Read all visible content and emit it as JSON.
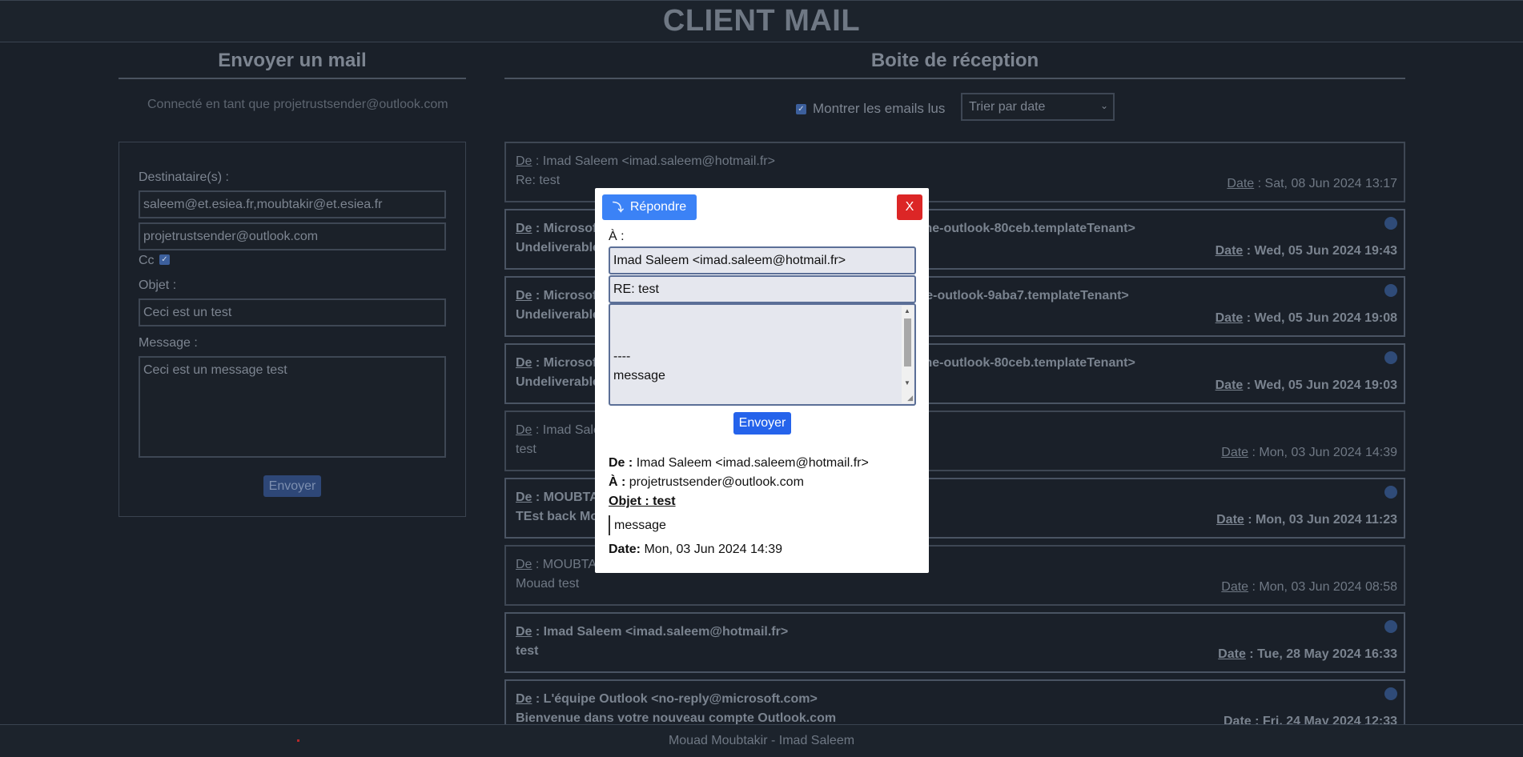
{
  "app": {
    "title": "CLIENT MAIL",
    "footer": "Mouad Moubtakir - Imad Saleem"
  },
  "compose": {
    "title": "Envoyer un mail",
    "connected_as": "Connecté en tant que projetrustsender@outlook.com",
    "to_label": "Destinataire(s) :",
    "to_value": "saleem@et.esiea.fr,moubtakir@et.esiea.fr",
    "cc_value": "projetrustsender@outlook.com",
    "cc_label": "Cc",
    "cc_checked": true,
    "subject_label": "Objet :",
    "subject_value": "Ceci est un test",
    "message_label": "Message :",
    "message_value": "Ceci est un message test",
    "send_label": "Envoyer"
  },
  "inbox": {
    "title": "Boite de réception",
    "show_read_label": "Montrer les emails lus",
    "show_read_checked": true,
    "sort_selected": "Trier par date",
    "from_prefix": "De",
    "date_prefix": "Date",
    "emails": [
      {
        "from": "Imad Saleem <imad.saleem@hotmail.fr>",
        "subject": "Re: test",
        "date": "Sat, 08 Jun 2024 13:17",
        "unread": false
      },
      {
        "from": "Microsoft Outlook <...5ab6ce41109e@sct-15-20-4755-11-msonline-outlook-80ceb.templateTenant>",
        "subject": "Undeliverable",
        "date": "Wed, 05 Jun 2024 19:43",
        "unread": true
      },
      {
        "from": "Microsoft Outlook <...5ab6ce41109e@sct-15-20-4801-0-msonline-outlook-9aba7.templateTenant>",
        "subject": "Undeliverable",
        "date": "Wed, 05 Jun 2024 19:08",
        "unread": true
      },
      {
        "from": "Microsoft Outlook <...5ab6ce41109e@sct-15-20-4755-11-msonline-outlook-80ceb.templateTenant>",
        "subject": "Undeliverable",
        "date": "Wed, 05 Jun 2024 19:03",
        "unread": true
      },
      {
        "from": "Imad Saleem <imad.saleem@hotmail.fr>",
        "subject": "test",
        "date": "Mon, 03 Jun 2024 14:39",
        "unread": false
      },
      {
        "from": "MOUBTAKIR",
        "subject": "TEst back Mouad",
        "date": "Mon, 03 Jun 2024 11:23",
        "unread": true
      },
      {
        "from": "MOUBTAKIR",
        "subject": "Mouad test",
        "date": "Mon, 03 Jun 2024 08:58",
        "unread": false
      },
      {
        "from": "Imad Saleem <imad.saleem@hotmail.fr>",
        "subject": "test",
        "date": "Tue, 28 May 2024 16:33",
        "unread": true
      },
      {
        "from": "L'équipe Outlook <no-reply@microsoft.com>",
        "subject": "Bienvenue dans votre nouveau compte Outlook.com",
        "date": "Fri, 24 May 2024 12:33",
        "unread": true
      }
    ]
  },
  "modal": {
    "reply_label": "Répondre",
    "close_label": "X",
    "to_label": "À :",
    "reply_to_value": "Imad Saleem <imad.saleem@hotmail.fr>",
    "reply_subject_value": "RE: test",
    "reply_body_separator": "----",
    "reply_body_quote": "message",
    "send_label": "Envoyer",
    "from_label": "De :",
    "from_value": "Imad Saleem <imad.saleem@hotmail.fr>",
    "to_info_label": "À :",
    "to_info_value": "projetrustsender@outlook.com",
    "subject_info": "Objet : test",
    "body": "message",
    "date_label": "Date:",
    "date_value": "Mon, 03 Jun 2024 14:39"
  }
}
